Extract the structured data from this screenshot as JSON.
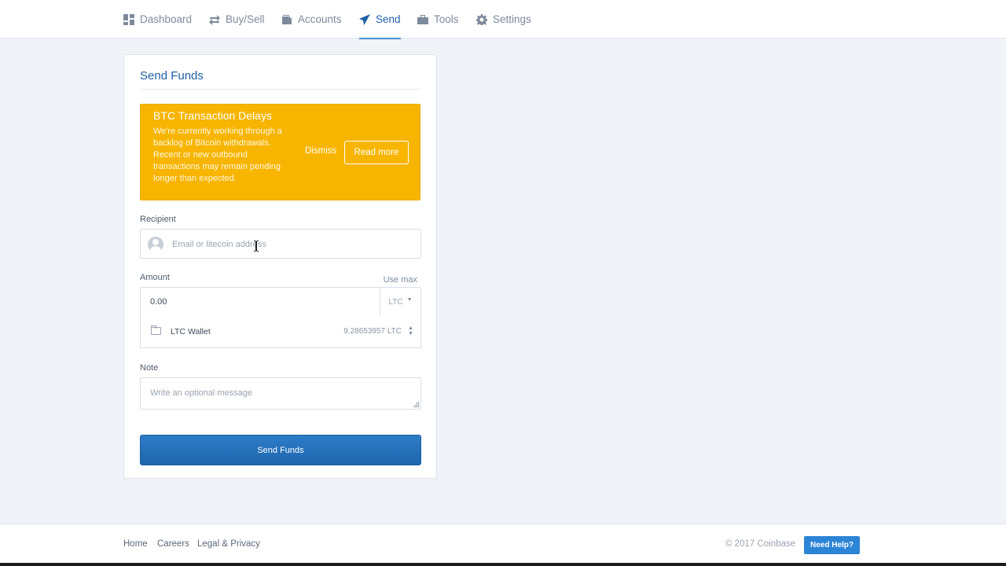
{
  "nav": {
    "items": [
      {
        "label": "Dashboard",
        "icon": "dashboard-icon",
        "active": false
      },
      {
        "label": "Buy/Sell",
        "icon": "exchange-arrows-icon",
        "active": false
      },
      {
        "label": "Accounts",
        "icon": "wallet-icon",
        "active": false
      },
      {
        "label": "Send",
        "icon": "paper-plane-icon",
        "active": true
      },
      {
        "label": "Tools",
        "icon": "toolbox-icon",
        "active": false
      },
      {
        "label": "Settings",
        "icon": "gear-icon",
        "active": false
      }
    ]
  },
  "send_form": {
    "title": "Send Funds",
    "alert": {
      "title": "BTC Transaction Delays",
      "body": "We're currently working through a backlog of Bitcoin withdrawals. Recent or new outbound transactions may remain pending longer than expected.",
      "dismiss_label": "Dismiss",
      "read_more_label": "Read more",
      "color": "#f7b500"
    },
    "recipient": {
      "label": "Recipient",
      "placeholder": "Email or litecoin address",
      "value": ""
    },
    "amount": {
      "label": "Amount",
      "use_max_label": "Use max",
      "value": "0.00",
      "currency": "LTC"
    },
    "wallet": {
      "name": "LTC Wallet",
      "balance": "9.28653957 LTC"
    },
    "note": {
      "label": "Note",
      "placeholder": "Write an optional message"
    },
    "submit_label": "Send Funds"
  },
  "footer": {
    "links": [
      "Home",
      "Careers",
      "Legal & Privacy"
    ],
    "copyright": "© 2017 Coinbase",
    "help_label": "Need Help?"
  },
  "colors": {
    "accent": "#1f5fa8",
    "button": "#2c7cc7",
    "alert": "#f7b500",
    "background": "#f0f3f8"
  }
}
